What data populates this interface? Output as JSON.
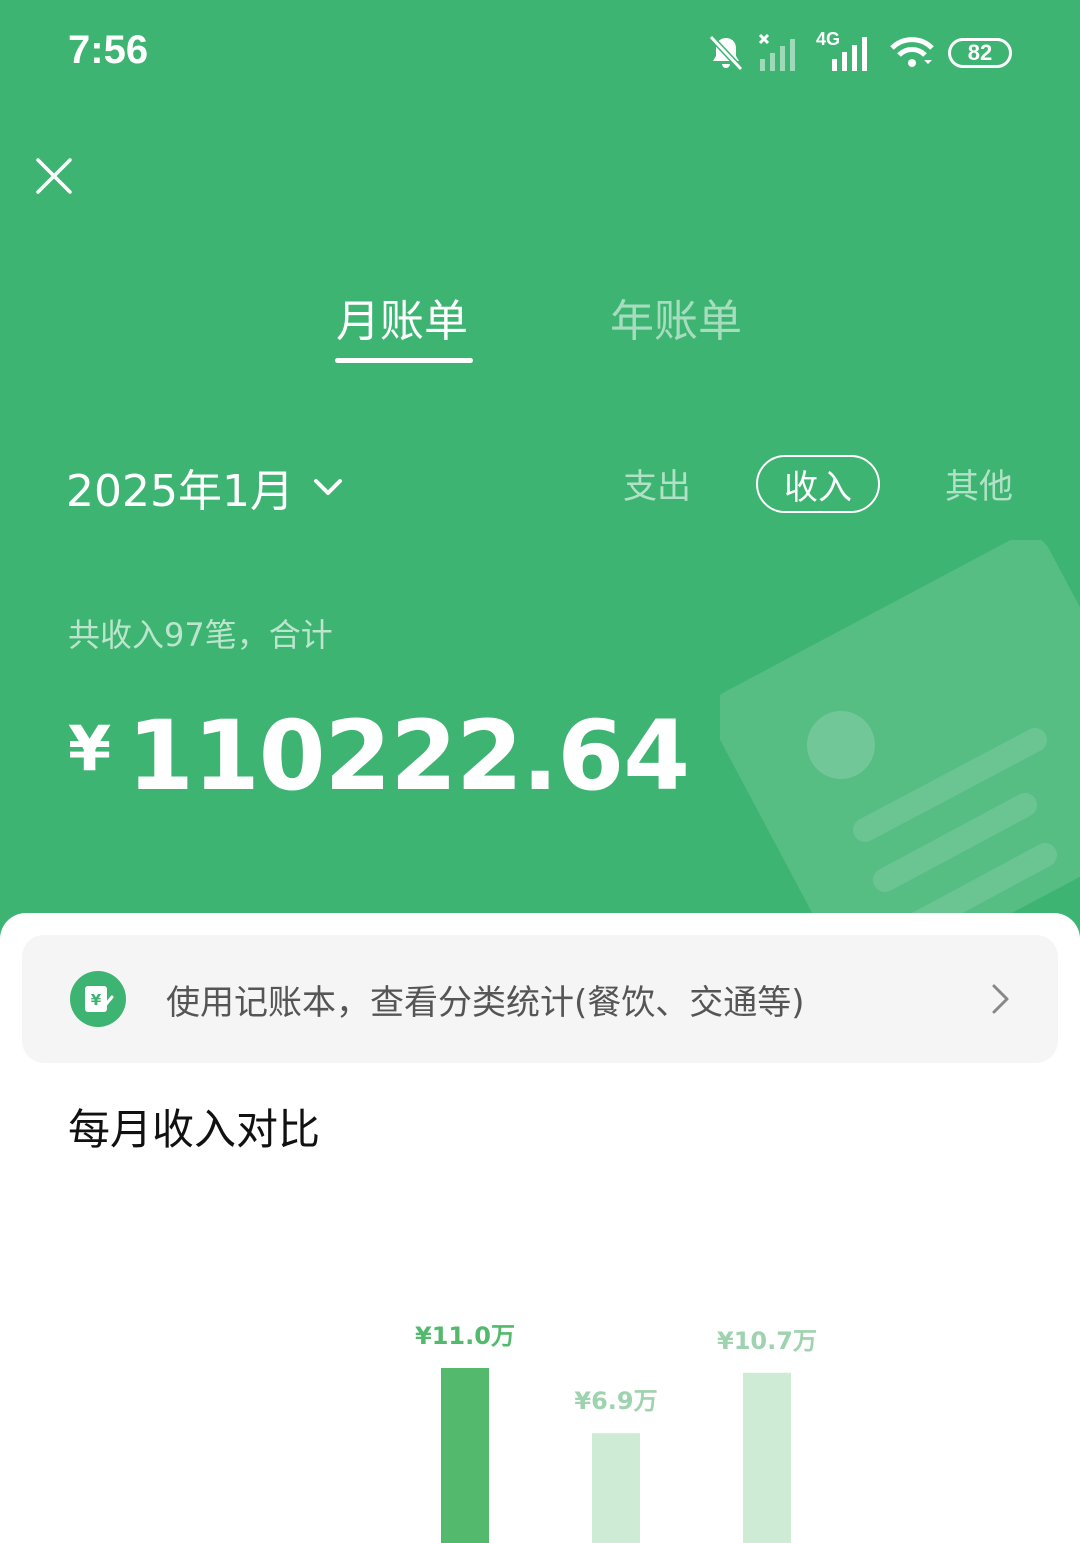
{
  "status_bar": {
    "time": "7:56",
    "network_label": "4G",
    "battery": "82",
    "icons": [
      "bell-muted-icon",
      "signal-no-service-icon",
      "signal-4g-icon",
      "wifi-icon",
      "battery-icon"
    ]
  },
  "header": {
    "close_icon": "close-icon",
    "tabs": [
      {
        "label": "月账单",
        "active": true
      },
      {
        "label": "年账单",
        "active": false
      }
    ],
    "month": "2025年1月",
    "filters": [
      {
        "label": "支出",
        "active": false
      },
      {
        "label": "收入",
        "active": true
      },
      {
        "label": "其他",
        "active": false
      }
    ],
    "summary": "共收入97笔，合计",
    "currency": "¥",
    "amount": "110222.64"
  },
  "promo": {
    "text": "使用记账本，查看分类统计(餐饮、交通等)",
    "icon": "ledger-icon"
  },
  "section_title": "每月收入对比",
  "colors": {
    "brand_green": "#3db471",
    "bar_active": "#52b96d",
    "bar_inactive": "#cdebd5",
    "label_inactive": "#9fd2ae"
  },
  "chart_data": {
    "type": "bar",
    "values": [
      11.0,
      6.9,
      10.7
    ],
    "labels": [
      "¥11.0万",
      "¥6.9万",
      "¥10.7万"
    ],
    "unit": "万",
    "highlight_index": 0
  }
}
